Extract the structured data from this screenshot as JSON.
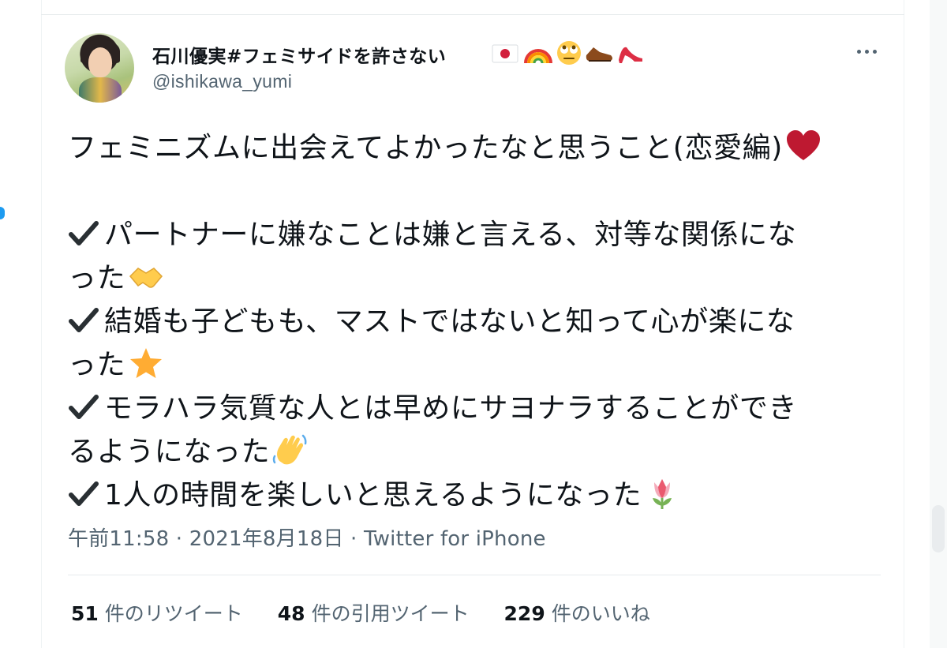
{
  "tweet": {
    "display_name": "石川優実#フェミサイドを許さない",
    "name_emojis": [
      "flag-japan-icon",
      "rainbow-icon",
      "face-rolling-eyes-icon",
      "mans-shoe-icon",
      "high-heel-icon"
    ],
    "handle": "@ishikawa_yumi",
    "title_line": "フェミニズムに出会えてよかったなと思うこと(恋愛編)",
    "title_emoji": "red-heart-icon",
    "items": [
      {
        "line1": "パートナーに嫌なことは嫌と言える、対等な関係にな",
        "line2": "った",
        "emoji": "handshake-icon"
      },
      {
        "line1": "結婚も子どもも、マストではないと知って心が楽にな",
        "line2": "った",
        "emoji": "star-icon"
      },
      {
        "line1": "モラハラ気質な人とは早めにサヨナラすることができ",
        "line2": "るようになった",
        "emoji": "waving-hand-icon"
      },
      {
        "line1": "1人の時間を楽しいと思えるようになった",
        "line2": "",
        "emoji": "tulip-icon"
      }
    ],
    "meta_time": "午前11:58",
    "meta_sep1": " · ",
    "meta_date": "2021年8月18日",
    "meta_sep2": " · ",
    "meta_source": "Twitter for iPhone",
    "stats": {
      "retweets_count": "51",
      "retweets_label": "件のリツイート",
      "quotes_count": "48",
      "quotes_label": "件の引用ツイート",
      "likes_count": "229",
      "likes_label": "件のいいね"
    }
  },
  "colors": {
    "text_primary": "#0f1419",
    "text_secondary": "#536471",
    "accent": "#1d9bf0",
    "divider": "#e7ebed"
  }
}
